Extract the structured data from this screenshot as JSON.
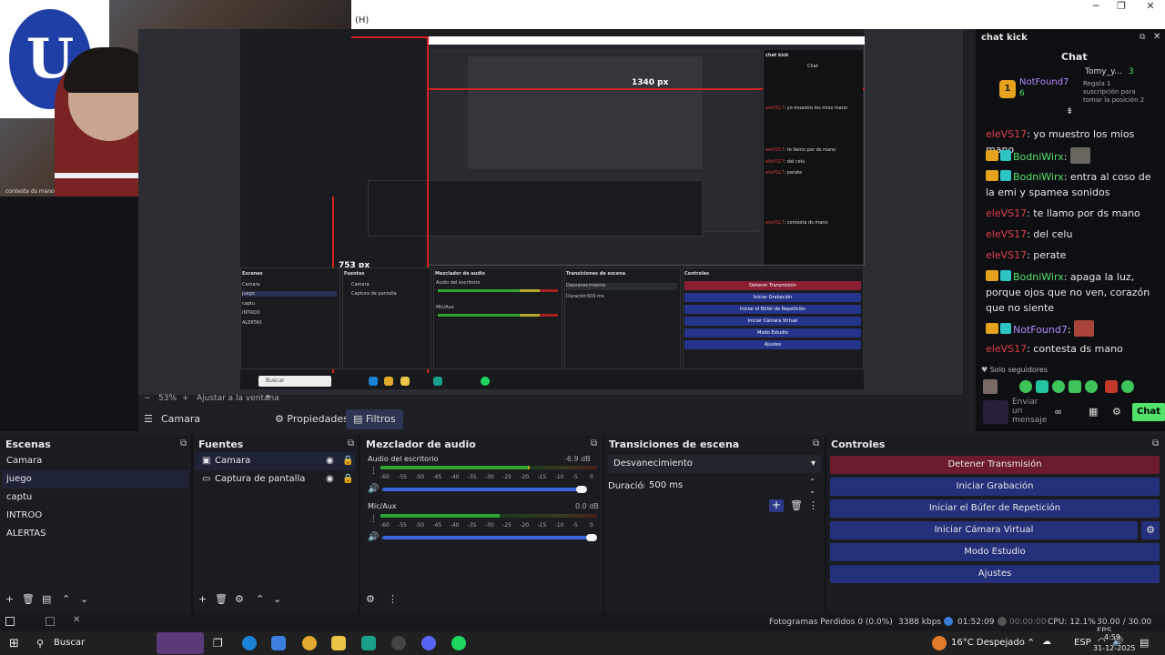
{
  "window": {
    "menu_fragment": "(H)"
  },
  "webcam": {
    "caption": "contesta ds mano",
    "flag_letter": "U"
  },
  "nested": {
    "width_label": "1340 px",
    "height_label": "753 px",
    "mini_chat_title": "chat kick",
    "mini_chat_header": "Chat",
    "mini_search": "Buscar"
  },
  "zoom": {
    "value": "53%",
    "fit_label": "Ajustar a la ventana"
  },
  "toolbar": {
    "source_name": "Camara",
    "props_label": "Propiedades",
    "filters_label": "Filtros"
  },
  "scenes": {
    "title": "Escenas",
    "items": [
      "Camara",
      "juego",
      "captu",
      "INTROO",
      "ALERTAS"
    ],
    "selected_index": 1
  },
  "sources": {
    "title": "Fuentes",
    "items": [
      "Camara",
      "Captura de pantalla"
    ]
  },
  "mixer": {
    "title": "Mezclador de audio",
    "tracks": [
      {
        "name": "Audio del escritorio",
        "db": "-6.9 dB",
        "level": 0.69,
        "fader": 0.95
      },
      {
        "name": "Mic/Aux",
        "db": "0.0 dB",
        "level": 0.55,
        "fader": 1.0
      }
    ],
    "ticks": [
      "-60",
      "-55",
      "-50",
      "-45",
      "-40",
      "-35",
      "-30",
      "-25",
      "-20",
      "-15",
      "-10",
      "-5",
      "0"
    ]
  },
  "transitions": {
    "title": "Transiciones de escena",
    "selected": "Desvanecimiento",
    "duration_label": "Duración",
    "duration_value": "500 ms"
  },
  "controls": {
    "title": "Controles",
    "buttons": [
      "Detener Transmisión",
      "Iniciar Grabación",
      "Iniciar el Búfer de Repetición",
      "Iniciar Cámara Virtual",
      "Modo Estudio",
      "Ajustes"
    ]
  },
  "chat": {
    "window_title": "chat kick",
    "header": "Chat",
    "top_user": "NotFound7",
    "top_user_count": "6",
    "gift_user": "Tomy_y...",
    "gift_count": "3",
    "gift_text": "Regala 1 suscripción para tomar la posición 2",
    "messages": [
      {
        "user": "eleVS17",
        "color": "red",
        "text": ": yo muestro los mios mano"
      },
      {
        "user": "BodniWirx",
        "color": "green",
        "text": ": "
      },
      {
        "user": "BodniWirx",
        "color": "green",
        "text": ": entra al coso de la emi y spamea sonidos"
      },
      {
        "user": "eleVS17",
        "color": "red",
        "text": ": te llamo por ds mano"
      },
      {
        "user": "eleVS17",
        "color": "red",
        "text": ": del celu"
      },
      {
        "user": "eleVS17",
        "color": "red",
        "text": ": perate"
      },
      {
        "user": "BodniWirx",
        "color": "green",
        "text": ": apaga la luz, porque ojos que no ven, corazón que no siente"
      },
      {
        "user": "NotFound7",
        "color": "purple",
        "text": ": "
      },
      {
        "user": "eleVS17",
        "color": "red",
        "text": ": contesta ds mano"
      }
    ],
    "followers_only": "Solo seguidores",
    "send_placeholder": "Enviar un mensaje",
    "send_button": "Chat"
  },
  "status": {
    "dropped": "Fotogramas Perdidos 0 (0.0%)",
    "bitrate": "3388 kbps",
    "live_time": "01:52:09",
    "rec_time": "00:00:00",
    "cpu": "CPU: 12.1%",
    "fps": "30.00 / 30.00 FPS"
  },
  "taskbar": {
    "search": "Buscar",
    "weather": "16°C  Despejado",
    "lang": "ESP",
    "time": "4:59",
    "date": "31-12-2025"
  }
}
